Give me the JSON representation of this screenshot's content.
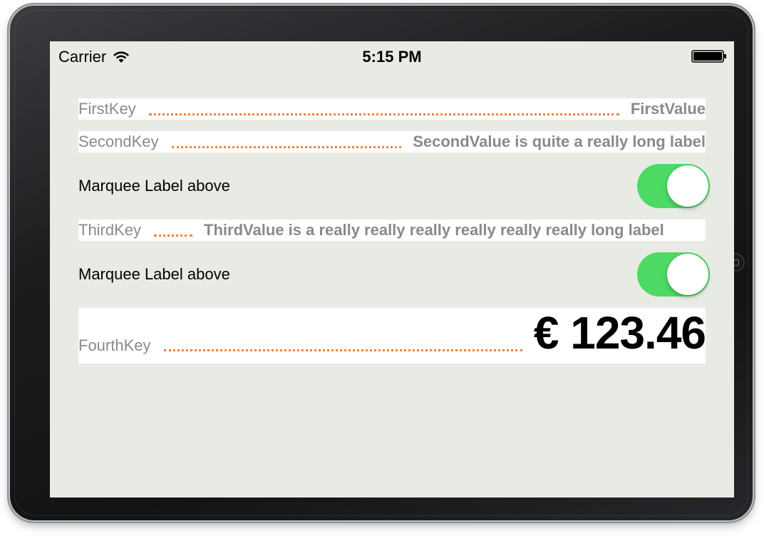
{
  "status_bar": {
    "carrier": "Carrier",
    "time": "5:15 PM",
    "wifi_icon": "wifi-icon",
    "battery_icon": "battery-icon"
  },
  "rows": [
    {
      "key": "FirstKey",
      "value": "FirstValue"
    },
    {
      "key": "SecondKey",
      "value": "SecondValue is quite a really long label"
    },
    {
      "key": "ThirdKey",
      "value": "ThirdValue is a  really really really really really really long label"
    },
    {
      "key": "FourthKey",
      "value": "€ 123.46"
    }
  ],
  "switches": [
    {
      "label": "Marquee Label above",
      "on": true
    },
    {
      "label": "Marquee Label above",
      "on": true
    }
  ],
  "colors": {
    "background": "#e8ebe4",
    "dots": "#f2813d",
    "switch_on": "#4cd964",
    "key_text": "#8a8a8a"
  }
}
